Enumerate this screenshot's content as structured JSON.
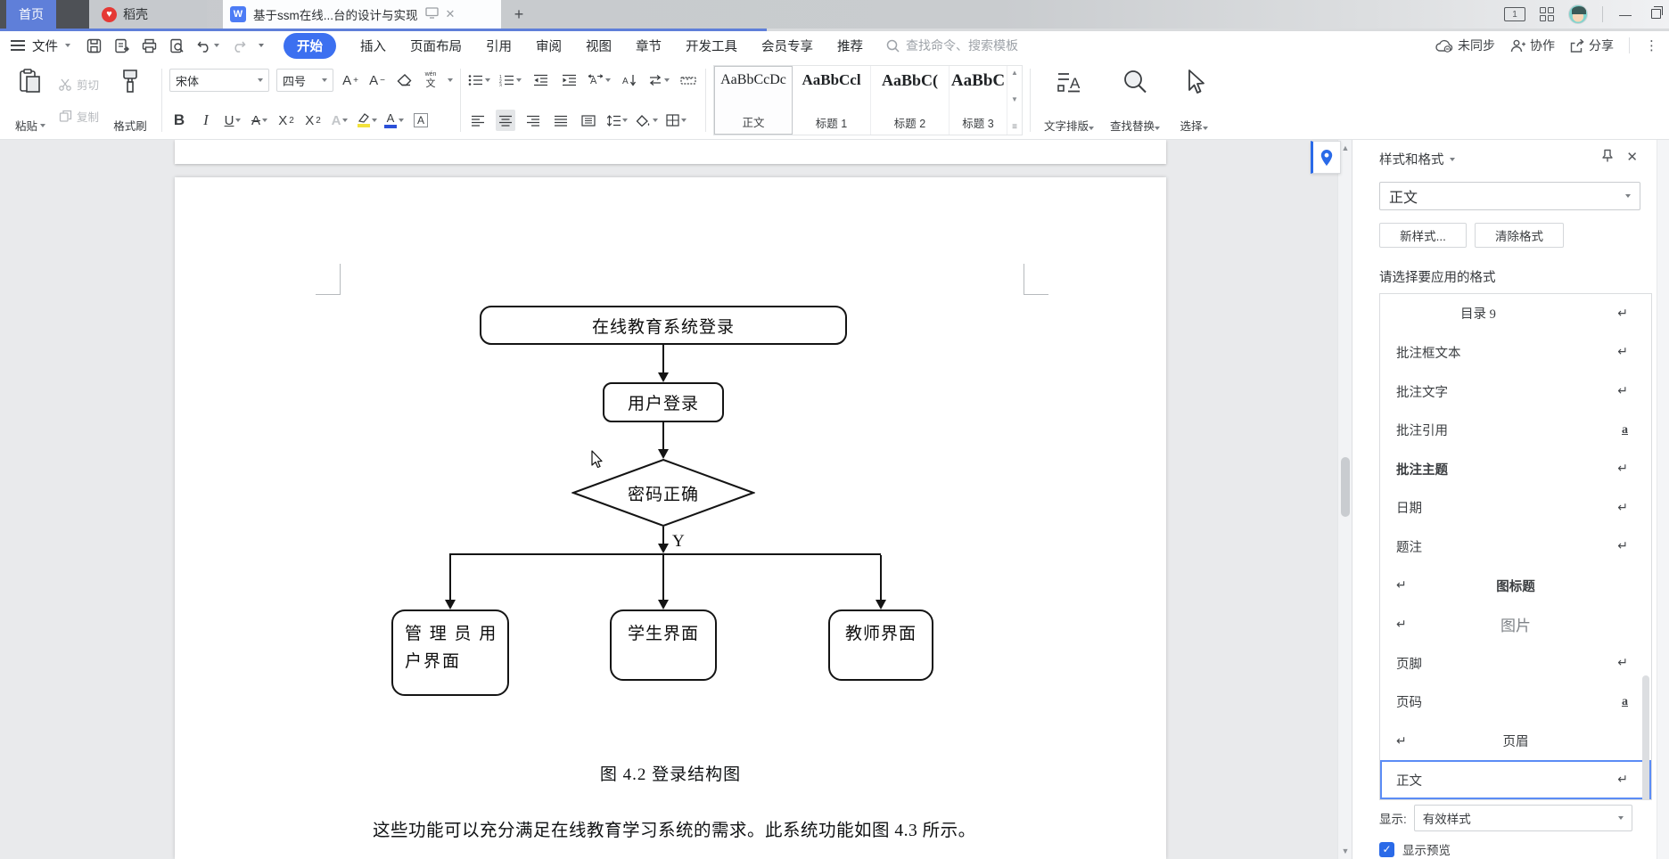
{
  "titlebar": {
    "home_tab": "首页",
    "docer_tab": "稻壳",
    "doc_tab_title": "基于ssm在线...台的设计与实现",
    "new_tab": "+",
    "window_badge": "1",
    "close_glyph": "✕",
    "min_glyph": "—"
  },
  "menubar": {
    "file_label": "文件",
    "tabs": [
      {
        "label": "开始"
      },
      {
        "label": "插入"
      },
      {
        "label": "页面布局"
      },
      {
        "label": "引用"
      },
      {
        "label": "审阅"
      },
      {
        "label": "视图"
      },
      {
        "label": "章节"
      },
      {
        "label": "开发工具"
      },
      {
        "label": "会员专享"
      },
      {
        "label": "推荐"
      }
    ],
    "search_placeholder": "查找命令、搜索模板",
    "sync_label": "未同步",
    "collab_label": "协作",
    "share_label": "分享",
    "more_glyph": "⋮"
  },
  "toolbar": {
    "paste": "粘贴",
    "cut": "剪切",
    "copy": "复制",
    "format_painter": "格式刷",
    "font_name": "宋体",
    "font_size": "四号",
    "styles_gallery": [
      {
        "preview": "AaBbCcDc",
        "label": "正文"
      },
      {
        "preview": "AaBbCcl",
        "label": "标题 1"
      },
      {
        "preview": "AaBbC(",
        "label": "标题 2"
      },
      {
        "preview": "AaBbC",
        "label": "标题 3"
      }
    ],
    "text_layout": "文字排版",
    "find_replace": "查找替换",
    "select": "选择"
  },
  "document": {
    "flowchart": {
      "start": "在线教育系统登录",
      "login": "用户登录",
      "decision": "密码正确",
      "branch_label": "Y",
      "leaves": [
        {
          "line1": "管 理 员 用",
          "line2": "户界面"
        },
        {
          "label": "学生界面"
        },
        {
          "label": "教师界面"
        }
      ]
    },
    "caption": "图 4.2  登录结构图",
    "paragraph": "这些功能可以充分满足在线教育学习系统的需求。此系统功能如图 4.3 所示。"
  },
  "panel": {
    "title": "样式和格式",
    "current_style": "正文",
    "new_style_btn": "新样式...",
    "clear_format_btn": "清除格式",
    "prompt": "请选择要应用的格式",
    "styles": [
      {
        "label": "目录 9",
        "mark": "↵"
      },
      {
        "label": "批注框文本",
        "mark": "↵"
      },
      {
        "label": "批注文字",
        "mark": "↵"
      },
      {
        "label": "批注引用",
        "mark": "a"
      },
      {
        "label": "批注主题",
        "mark": "↵"
      },
      {
        "label": "日期",
        "mark": "↵"
      },
      {
        "label": "题注",
        "mark": "↵"
      },
      {
        "label": "图标题",
        "mark": "↵"
      },
      {
        "label": "图片",
        "mark": "↵"
      },
      {
        "label": "页脚",
        "mark": "↵"
      },
      {
        "label": "页码",
        "mark": "a"
      },
      {
        "label": "页眉",
        "mark": "↵"
      },
      {
        "label": "正文",
        "mark": "↵"
      }
    ],
    "show_label": "显示:",
    "show_value": "有效样式",
    "preview_checkbox_label": "显示预览"
  },
  "colors": {
    "accent_blue": "#3C70F0",
    "home_tab_blue": "#5F7FD9",
    "checkbox_blue": "#2A6AE8",
    "docer_red": "#E53935"
  }
}
